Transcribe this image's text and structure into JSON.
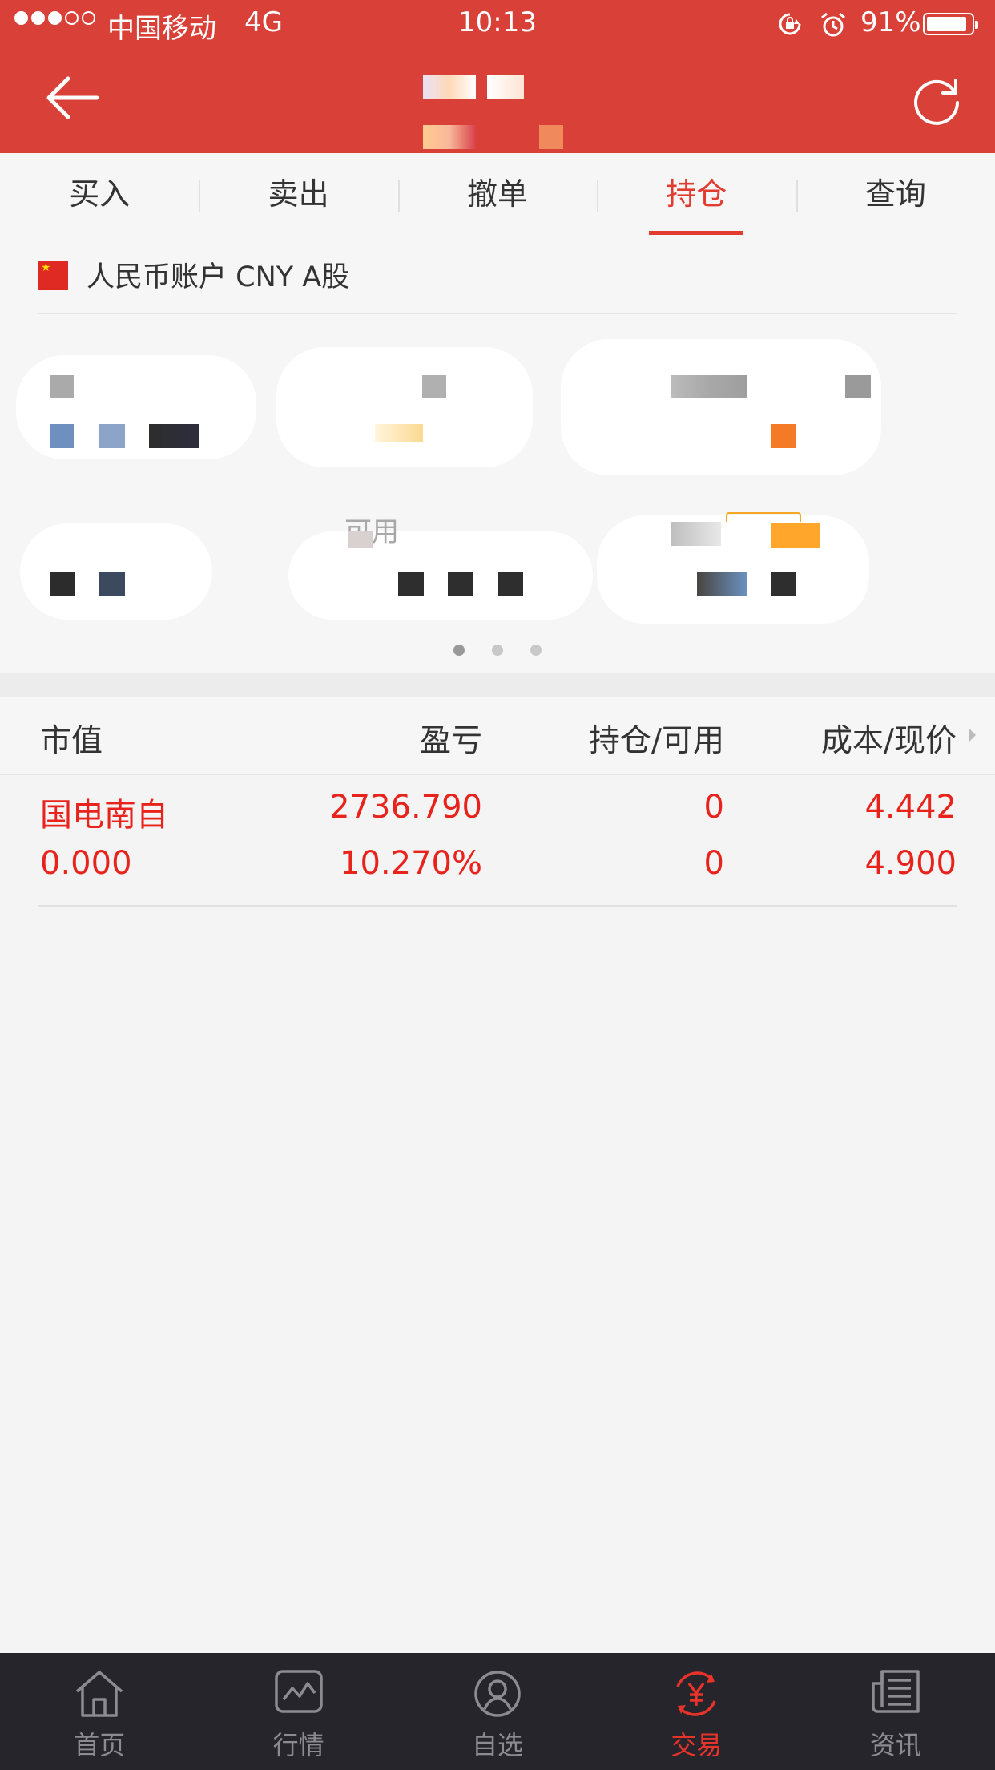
{
  "status_bar": {
    "carrier": "中国移动",
    "network": "4G",
    "time": "10:13",
    "battery": "91%",
    "battery_level": 0.91
  },
  "tabs": [
    {
      "label": "买入",
      "active": false
    },
    {
      "label": "卖出",
      "active": false
    },
    {
      "label": "撤单",
      "active": false
    },
    {
      "label": "持仓",
      "active": true
    },
    {
      "label": "查询",
      "active": false
    }
  ],
  "account": {
    "label": "人民币账户 CNY A股",
    "available_label": "可用"
  },
  "pager": {
    "pages": 3,
    "current": 1
  },
  "holdings": {
    "headers": [
      "市值",
      "盈亏",
      "持仓/可用",
      "成本/现价"
    ],
    "rows": [
      {
        "name": "国电南自",
        "market_value": "0.000",
        "pnl": "2736.790",
        "pnl_pct": "10.270%",
        "position": "0",
        "available": "0",
        "cost": "4.442",
        "price": "4.900"
      }
    ]
  },
  "nav": [
    {
      "label": "首页",
      "icon": "home-icon",
      "active": false
    },
    {
      "label": "行情",
      "icon": "chart-icon",
      "active": false
    },
    {
      "label": "自选",
      "icon": "user-icon",
      "active": false
    },
    {
      "label": "交易",
      "icon": "trade-icon",
      "active": true
    },
    {
      "label": "资讯",
      "icon": "news-icon",
      "active": false
    }
  ],
  "colors": {
    "header": "#d94038",
    "accent": "#e23b30",
    "profit": "#e8231c",
    "nav_bg": "#25252b"
  }
}
